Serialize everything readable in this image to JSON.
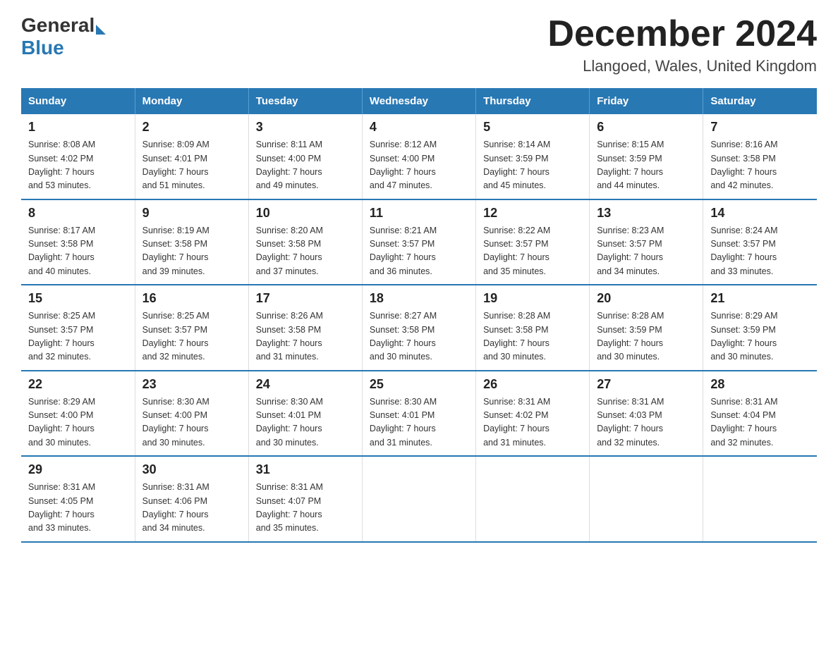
{
  "header": {
    "logo_general": "General",
    "logo_blue": "Blue",
    "month_title": "December 2024",
    "location": "Llangoed, Wales, United Kingdom"
  },
  "days_of_week": [
    "Sunday",
    "Monday",
    "Tuesday",
    "Wednesday",
    "Thursday",
    "Friday",
    "Saturday"
  ],
  "weeks": [
    [
      {
        "date": "1",
        "sunrise": "8:08 AM",
        "sunset": "4:02 PM",
        "daylight": "7 hours and 53 minutes."
      },
      {
        "date": "2",
        "sunrise": "8:09 AM",
        "sunset": "4:01 PM",
        "daylight": "7 hours and 51 minutes."
      },
      {
        "date": "3",
        "sunrise": "8:11 AM",
        "sunset": "4:00 PM",
        "daylight": "7 hours and 49 minutes."
      },
      {
        "date": "4",
        "sunrise": "8:12 AM",
        "sunset": "4:00 PM",
        "daylight": "7 hours and 47 minutes."
      },
      {
        "date": "5",
        "sunrise": "8:14 AM",
        "sunset": "3:59 PM",
        "daylight": "7 hours and 45 minutes."
      },
      {
        "date": "6",
        "sunrise": "8:15 AM",
        "sunset": "3:59 PM",
        "daylight": "7 hours and 44 minutes."
      },
      {
        "date": "7",
        "sunrise": "8:16 AM",
        "sunset": "3:58 PM",
        "daylight": "7 hours and 42 minutes."
      }
    ],
    [
      {
        "date": "8",
        "sunrise": "8:17 AM",
        "sunset": "3:58 PM",
        "daylight": "7 hours and 40 minutes."
      },
      {
        "date": "9",
        "sunrise": "8:19 AM",
        "sunset": "3:58 PM",
        "daylight": "7 hours and 39 minutes."
      },
      {
        "date": "10",
        "sunrise": "8:20 AM",
        "sunset": "3:58 PM",
        "daylight": "7 hours and 37 minutes."
      },
      {
        "date": "11",
        "sunrise": "8:21 AM",
        "sunset": "3:57 PM",
        "daylight": "7 hours and 36 minutes."
      },
      {
        "date": "12",
        "sunrise": "8:22 AM",
        "sunset": "3:57 PM",
        "daylight": "7 hours and 35 minutes."
      },
      {
        "date": "13",
        "sunrise": "8:23 AM",
        "sunset": "3:57 PM",
        "daylight": "7 hours and 34 minutes."
      },
      {
        "date": "14",
        "sunrise": "8:24 AM",
        "sunset": "3:57 PM",
        "daylight": "7 hours and 33 minutes."
      }
    ],
    [
      {
        "date": "15",
        "sunrise": "8:25 AM",
        "sunset": "3:57 PM",
        "daylight": "7 hours and 32 minutes."
      },
      {
        "date": "16",
        "sunrise": "8:25 AM",
        "sunset": "3:57 PM",
        "daylight": "7 hours and 32 minutes."
      },
      {
        "date": "17",
        "sunrise": "8:26 AM",
        "sunset": "3:58 PM",
        "daylight": "7 hours and 31 minutes."
      },
      {
        "date": "18",
        "sunrise": "8:27 AM",
        "sunset": "3:58 PM",
        "daylight": "7 hours and 30 minutes."
      },
      {
        "date": "19",
        "sunrise": "8:28 AM",
        "sunset": "3:58 PM",
        "daylight": "7 hours and 30 minutes."
      },
      {
        "date": "20",
        "sunrise": "8:28 AM",
        "sunset": "3:59 PM",
        "daylight": "7 hours and 30 minutes."
      },
      {
        "date": "21",
        "sunrise": "8:29 AM",
        "sunset": "3:59 PM",
        "daylight": "7 hours and 30 minutes."
      }
    ],
    [
      {
        "date": "22",
        "sunrise": "8:29 AM",
        "sunset": "4:00 PM",
        "daylight": "7 hours and 30 minutes."
      },
      {
        "date": "23",
        "sunrise": "8:30 AM",
        "sunset": "4:00 PM",
        "daylight": "7 hours and 30 minutes."
      },
      {
        "date": "24",
        "sunrise": "8:30 AM",
        "sunset": "4:01 PM",
        "daylight": "7 hours and 30 minutes."
      },
      {
        "date": "25",
        "sunrise": "8:30 AM",
        "sunset": "4:01 PM",
        "daylight": "7 hours and 31 minutes."
      },
      {
        "date": "26",
        "sunrise": "8:31 AM",
        "sunset": "4:02 PM",
        "daylight": "7 hours and 31 minutes."
      },
      {
        "date": "27",
        "sunrise": "8:31 AM",
        "sunset": "4:03 PM",
        "daylight": "7 hours and 32 minutes."
      },
      {
        "date": "28",
        "sunrise": "8:31 AM",
        "sunset": "4:04 PM",
        "daylight": "7 hours and 32 minutes."
      }
    ],
    [
      {
        "date": "29",
        "sunrise": "8:31 AM",
        "sunset": "4:05 PM",
        "daylight": "7 hours and 33 minutes."
      },
      {
        "date": "30",
        "sunrise": "8:31 AM",
        "sunset": "4:06 PM",
        "daylight": "7 hours and 34 minutes."
      },
      {
        "date": "31",
        "sunrise": "8:31 AM",
        "sunset": "4:07 PM",
        "daylight": "7 hours and 35 minutes."
      },
      null,
      null,
      null,
      null
    ]
  ],
  "labels": {
    "sunrise": "Sunrise:",
    "sunset": "Sunset:",
    "daylight": "Daylight:"
  }
}
